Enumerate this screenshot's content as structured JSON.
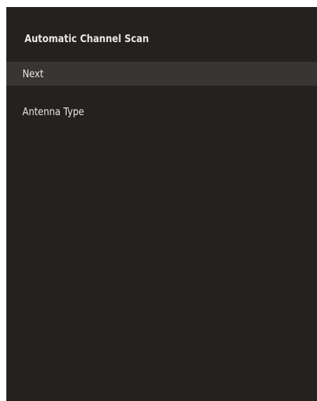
{
  "panel": {
    "title": "Automatic Channel Scan",
    "items": [
      {
        "label": "Next",
        "selected": true
      },
      {
        "label": "Antenna Type",
        "selected": false
      }
    ]
  },
  "colors": {
    "panel_background": "#242121",
    "selected_background": "#383535",
    "text": "#e9e6e4"
  }
}
